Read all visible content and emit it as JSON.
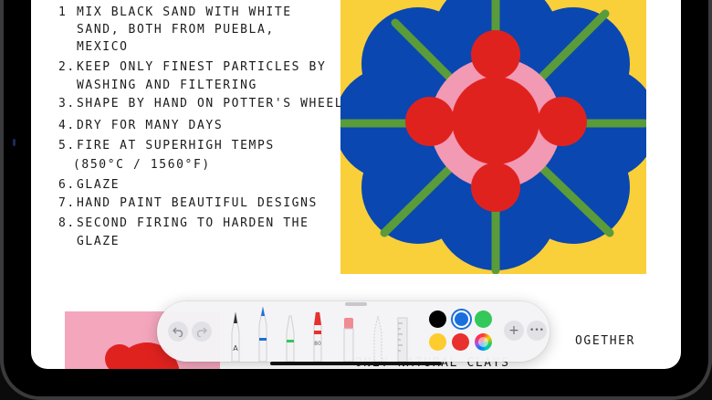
{
  "note": {
    "steps": [
      {
        "num": "1",
        "lines": [
          "Mix black sand with white",
          "sand, both from Puebla,",
          "Mexico"
        ]
      },
      {
        "num": "2.",
        "lines": [
          "Keep only finest particles by",
          "washing and filtering"
        ]
      },
      {
        "num": "3.",
        "lines": [
          "Shape by hand on potter's wheel"
        ]
      },
      {
        "num": "4.",
        "lines": [
          "Dry for many days"
        ]
      },
      {
        "num": "5.",
        "lines": [
          "Fire at superhigh temps",
          "(850°C / 1560°F)"
        ]
      },
      {
        "num": "6.",
        "lines": [
          "Glaze"
        ]
      },
      {
        "num": "7.",
        "lines": [
          "Hand paint beautiful designs"
        ]
      },
      {
        "num": "8.",
        "lines": [
          "Second firing to harden the",
          "glaze"
        ]
      }
    ],
    "side_lines": [
      "ogether",
      "— Only natural clays"
    ]
  },
  "toolbar": {
    "undo_icon": "undo-arrow",
    "redo_icon": "redo-arrow",
    "pen_label": "A",
    "marker_label": "80",
    "tools": [
      "pen",
      "monoline-pen",
      "marker",
      "crayon",
      "eraser",
      "lasso",
      "ruler"
    ],
    "colors": [
      "#000000",
      "#1b6fdc",
      "#34c759",
      "#ffcc2f",
      "#e8302e",
      "color-wheel"
    ],
    "selected_color": "#1b6fdc",
    "add_icon": "+",
    "more_icon": "•••"
  },
  "colors": {
    "tile_background": "#f9cf3a",
    "flower_blue": "#0a47b0",
    "flower_pink": "#f299b4",
    "flower_red": "#e0221f",
    "stem_green": "#5a9b3a"
  }
}
